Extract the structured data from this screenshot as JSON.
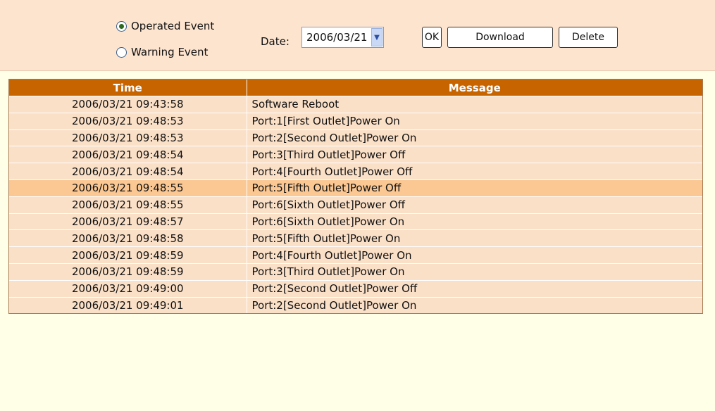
{
  "controls": {
    "radio_operated": "Operated Event",
    "radio_warning": "Warning Event",
    "date_label": "Date:",
    "date_value": "2006/03/21",
    "ok_label": "OK",
    "download_label": "Download",
    "delete_label": "Delete"
  },
  "table": {
    "headers": [
      "Time",
      "Message"
    ],
    "rows": [
      {
        "time": "2006/03/21 09:43:58",
        "message": "Software Reboot"
      },
      {
        "time": "2006/03/21 09:48:53",
        "message": "Port:1[First Outlet]Power On"
      },
      {
        "time": "2006/03/21 09:48:53",
        "message": "Port:2[Second Outlet]Power On"
      },
      {
        "time": "2006/03/21 09:48:54",
        "message": "Port:3[Third Outlet]Power Off"
      },
      {
        "time": "2006/03/21 09:48:54",
        "message": "Port:4[Fourth Outlet]Power Off"
      },
      {
        "time": "2006/03/21 09:48:55",
        "message": "Port:5[Fifth Outlet]Power Off"
      },
      {
        "time": "2006/03/21 09:48:55",
        "message": "Port:6[Sixth Outlet]Power Off"
      },
      {
        "time": "2006/03/21 09:48:57",
        "message": "Port:6[Sixth Outlet]Power On"
      },
      {
        "time": "2006/03/21 09:48:58",
        "message": "Port:5[Fifth Outlet]Power On"
      },
      {
        "time": "2006/03/21 09:48:59",
        "message": "Port:4[Fourth Outlet]Power On"
      },
      {
        "time": "2006/03/21 09:48:59",
        "message": "Port:3[Third Outlet]Power On"
      },
      {
        "time": "2006/03/21 09:49:00",
        "message": "Port:2[Second Outlet]Power Off"
      },
      {
        "time": "2006/03/21 09:49:01",
        "message": "Port:2[Second Outlet]Power On"
      }
    ]
  },
  "colors": {
    "header_bg": "#c86400",
    "row_bg": "#fbe0c8",
    "row_highlight": "#fbc893",
    "page_bg": "#fffee6",
    "topbar_bg": "#fde4cf"
  },
  "icons": {
    "select_arrow": "chevron-down-icon"
  }
}
